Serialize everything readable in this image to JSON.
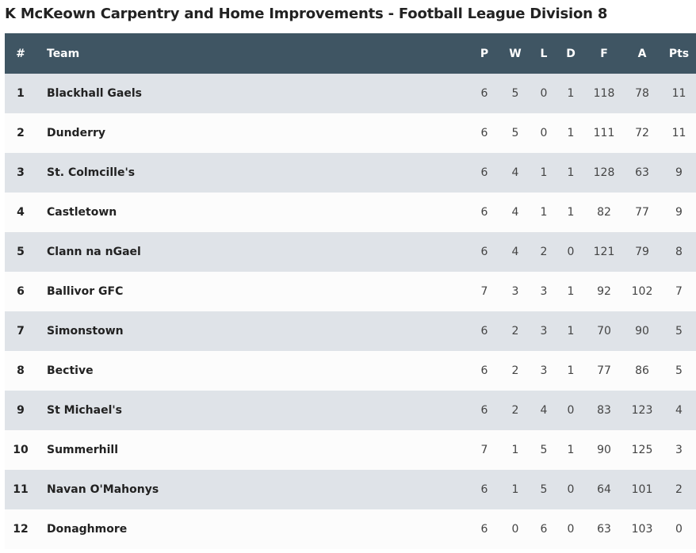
{
  "title": "K McKeown Carpentry and Home Improvements - Football League Division 8",
  "columns": {
    "pos": "#",
    "team": "Team",
    "p": "P",
    "w": "W",
    "l": "L",
    "d": "D",
    "f": "F",
    "a": "A",
    "pts": "Pts"
  },
  "rows": [
    {
      "pos": "1",
      "team": "Blackhall Gaels",
      "p": "6",
      "w": "5",
      "l": "0",
      "d": "1",
      "f": "118",
      "a": "78",
      "pts": "11"
    },
    {
      "pos": "2",
      "team": "Dunderry",
      "p": "6",
      "w": "5",
      "l": "0",
      "d": "1",
      "f": "111",
      "a": "72",
      "pts": "11"
    },
    {
      "pos": "3",
      "team": "St. Colmcille's",
      "p": "6",
      "w": "4",
      "l": "1",
      "d": "1",
      "f": "128",
      "a": "63",
      "pts": "9"
    },
    {
      "pos": "4",
      "team": "Castletown",
      "p": "6",
      "w": "4",
      "l": "1",
      "d": "1",
      "f": "82",
      "a": "77",
      "pts": "9"
    },
    {
      "pos": "5",
      "team": "Clann na nGael",
      "p": "6",
      "w": "4",
      "l": "2",
      "d": "0",
      "f": "121",
      "a": "79",
      "pts": "8"
    },
    {
      "pos": "6",
      "team": "Ballivor GFC",
      "p": "7",
      "w": "3",
      "l": "3",
      "d": "1",
      "f": "92",
      "a": "102",
      "pts": "7"
    },
    {
      "pos": "7",
      "team": "Simonstown",
      "p": "6",
      "w": "2",
      "l": "3",
      "d": "1",
      "f": "70",
      "a": "90",
      "pts": "5"
    },
    {
      "pos": "8",
      "team": "Bective",
      "p": "6",
      "w": "2",
      "l": "3",
      "d": "1",
      "f": "77",
      "a": "86",
      "pts": "5"
    },
    {
      "pos": "9",
      "team": "St Michael's",
      "p": "6",
      "w": "2",
      "l": "4",
      "d": "0",
      "f": "83",
      "a": "123",
      "pts": "4"
    },
    {
      "pos": "10",
      "team": "Summerhill",
      "p": "7",
      "w": "1",
      "l": "5",
      "d": "1",
      "f": "90",
      "a": "125",
      "pts": "3"
    },
    {
      "pos": "11",
      "team": "Navan O'Mahonys",
      "p": "6",
      "w": "1",
      "l": "5",
      "d": "0",
      "f": "64",
      "a": "101",
      "pts": "2"
    },
    {
      "pos": "12",
      "team": "Donaghmore",
      "p": "6",
      "w": "0",
      "l": "6",
      "d": "0",
      "f": "63",
      "a": "103",
      "pts": "0"
    }
  ],
  "colors": {
    "header_bg": "#3f5563",
    "row_odd": "#dfe3e8",
    "row_even": "#fcfcfc"
  }
}
